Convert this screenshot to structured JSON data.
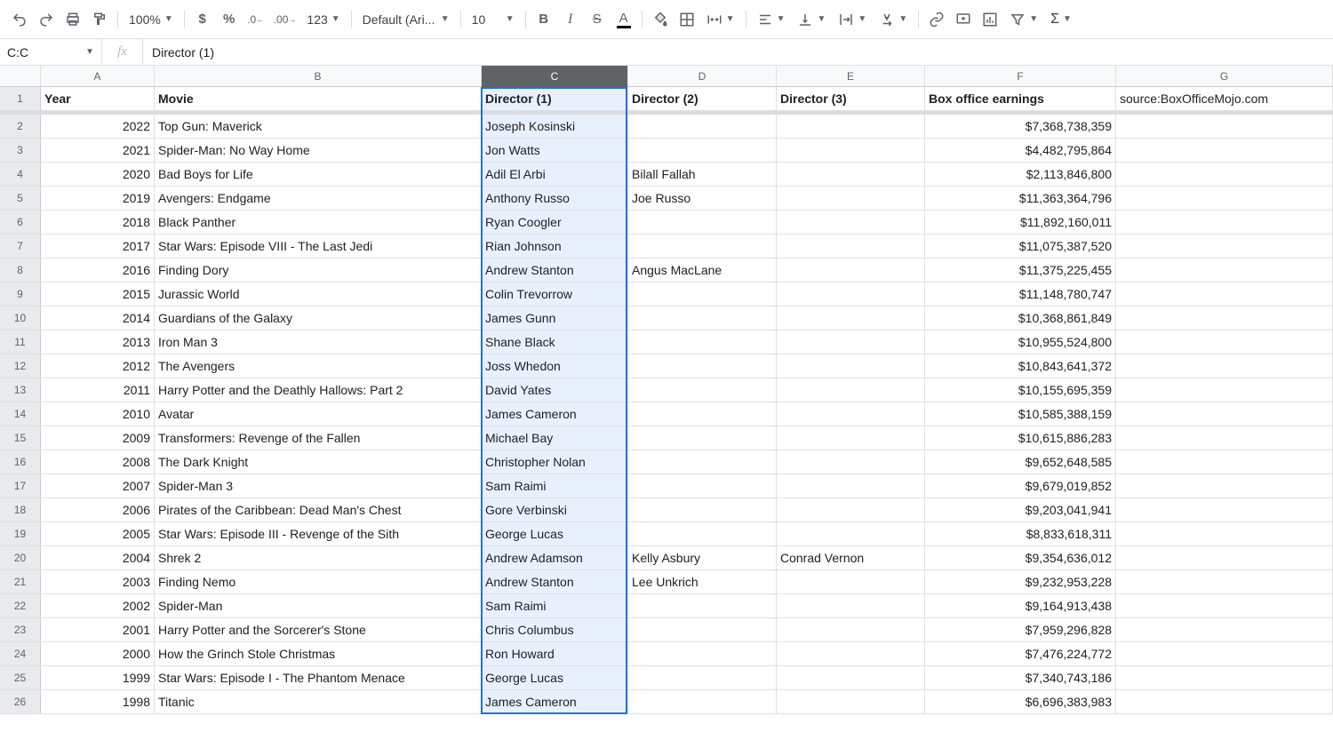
{
  "toolbar": {
    "zoom": "100%",
    "font": "Default (Ari...",
    "fontsize": "10"
  },
  "namebox": "C:C",
  "formula": "Director (1)",
  "columns": [
    "A",
    "B",
    "C",
    "D",
    "E",
    "F",
    "G"
  ],
  "selectedColIndex": 2,
  "headers": {
    "A": "Year",
    "B": "Movie",
    "C": "Director (1)",
    "D": "Director (2)",
    "E": "Director (3)",
    "F": "Box office earnings",
    "G_prefix": "source: ",
    "G_link": "BoxOfficeMojo.com"
  },
  "rows": [
    {
      "n": 2,
      "A": "2022",
      "B": "Top Gun: Maverick",
      "C": "Joseph Kosinski",
      "D": "",
      "E": "",
      "F": "$7,368,738,359"
    },
    {
      "n": 3,
      "A": "2021",
      "B": "Spider-Man: No Way Home",
      "C": "Jon Watts",
      "D": "",
      "E": "",
      "F": "$4,482,795,864"
    },
    {
      "n": 4,
      "A": "2020",
      "B": "Bad Boys for Life",
      "C": "Adil El Arbi",
      "D": "Bilall Fallah",
      "E": "",
      "F": "$2,113,846,800"
    },
    {
      "n": 5,
      "A": "2019",
      "B": "Avengers: Endgame",
      "C": "Anthony Russo",
      "D": "Joe Russo",
      "E": "",
      "F": "$11,363,364,796"
    },
    {
      "n": 6,
      "A": "2018",
      "B": "Black Panther",
      "C": "Ryan Coogler",
      "D": "",
      "E": "",
      "F": "$11,892,160,011"
    },
    {
      "n": 7,
      "A": "2017",
      "B": "Star Wars: Episode VIII - The Last Jedi",
      "C": "Rian Johnson",
      "D": "",
      "E": "",
      "F": "$11,075,387,520"
    },
    {
      "n": 8,
      "A": "2016",
      "B": "Finding Dory",
      "C": "Andrew Stanton",
      "D": "Angus MacLane",
      "E": "",
      "F": "$11,375,225,455"
    },
    {
      "n": 9,
      "A": "2015",
      "B": "Jurassic World",
      "C": "Colin Trevorrow",
      "D": "",
      "E": "",
      "F": "$11,148,780,747"
    },
    {
      "n": 10,
      "A": "2014",
      "B": "Guardians of the Galaxy",
      "C": "James Gunn",
      "D": "",
      "E": "",
      "F": "$10,368,861,849"
    },
    {
      "n": 11,
      "A": "2013",
      "B": "Iron Man 3",
      "C": "Shane Black",
      "D": "",
      "E": "",
      "F": "$10,955,524,800"
    },
    {
      "n": 12,
      "A": "2012",
      "B": "The Avengers",
      "C": "Joss Whedon",
      "D": "",
      "E": "",
      "F": "$10,843,641,372"
    },
    {
      "n": 13,
      "A": "2011",
      "B": "Harry Potter and the Deathly Hallows: Part 2",
      "C": "David Yates",
      "D": "",
      "E": "",
      "F": "$10,155,695,359"
    },
    {
      "n": 14,
      "A": "2010",
      "B": "Avatar",
      "C": "James Cameron",
      "D": "",
      "E": "",
      "F": "$10,585,388,159"
    },
    {
      "n": 15,
      "A": "2009",
      "B": "Transformers: Revenge of the Fallen",
      "C": "Michael Bay",
      "D": "",
      "E": "",
      "F": "$10,615,886,283"
    },
    {
      "n": 16,
      "A": "2008",
      "B": "The Dark Knight",
      "C": "Christopher Nolan",
      "D": "",
      "E": "",
      "F": "$9,652,648,585"
    },
    {
      "n": 17,
      "A": "2007",
      "B": "Spider-Man 3",
      "C": "Sam Raimi",
      "D": "",
      "E": "",
      "F": "$9,679,019,852"
    },
    {
      "n": 18,
      "A": "2006",
      "B": "Pirates of the Caribbean: Dead Man's Chest",
      "C": "Gore Verbinski",
      "D": "",
      "E": "",
      "F": "$9,203,041,941"
    },
    {
      "n": 19,
      "A": "2005",
      "B": "Star Wars: Episode III - Revenge of the Sith",
      "C": "George Lucas",
      "D": "",
      "E": "",
      "F": "$8,833,618,311"
    },
    {
      "n": 20,
      "A": "2004",
      "B": "Shrek 2",
      "C": "Andrew Adamson",
      "D": "Kelly Asbury",
      "E": "Conrad Vernon",
      "F": "$9,354,636,012"
    },
    {
      "n": 21,
      "A": "2003",
      "B": "Finding Nemo",
      "C": "Andrew Stanton",
      "D": "Lee Unkrich",
      "E": "",
      "F": "$9,232,953,228"
    },
    {
      "n": 22,
      "A": "2002",
      "B": "Spider-Man",
      "C": "Sam Raimi",
      "D": "",
      "E": "",
      "F": "$9,164,913,438"
    },
    {
      "n": 23,
      "A": "2001",
      "B": "Harry Potter and the Sorcerer's Stone",
      "C": "Chris Columbus",
      "D": "",
      "E": "",
      "F": "$7,959,296,828"
    },
    {
      "n": 24,
      "A": "2000",
      "B": "How the Grinch Stole Christmas",
      "C": "Ron Howard",
      "D": "",
      "E": "",
      "F": "$7,476,224,772"
    },
    {
      "n": 25,
      "A": "1999",
      "B": "Star Wars: Episode I - The Phantom Menace",
      "C": "George Lucas",
      "D": "",
      "E": "",
      "F": "$7,340,743,186"
    },
    {
      "n": 26,
      "A": "1998",
      "B": "Titanic",
      "C": "James Cameron",
      "D": "",
      "E": "",
      "F": "$6,696,383,983"
    }
  ]
}
